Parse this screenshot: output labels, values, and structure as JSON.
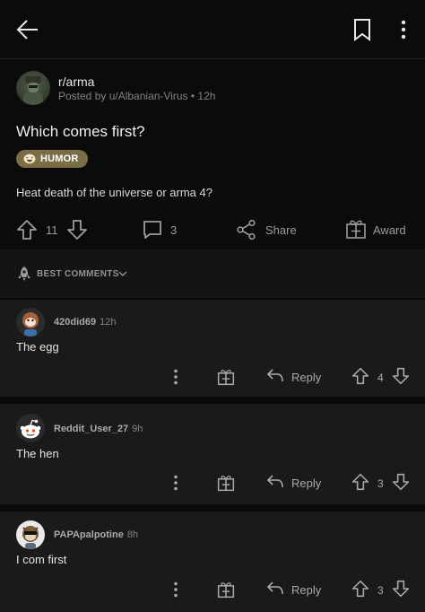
{
  "header": {
    "back_icon": "arrow-left-icon",
    "bookmark_icon": "bookmark-icon",
    "more_icon": "more-vertical-icon"
  },
  "post": {
    "subreddit": "r/arma",
    "posted_by": "Posted by u/Albanian-Virus • 12h",
    "title": "Which comes first?",
    "flair": "HUMOR",
    "body": "Heat death of the universe or arma 4?",
    "votes": "11",
    "comments": "3",
    "share_label": "Share",
    "award_label": "Award",
    "flair_color": "#7b6d45"
  },
  "sort": {
    "label": "BEST COMMENTS"
  },
  "comments": [
    {
      "user": "420did69",
      "time": "12h",
      "text": "The egg",
      "reply_label": "Reply",
      "score": "4"
    },
    {
      "user": "Reddit_User_27",
      "time": "9h",
      "text": "The hen",
      "reply_label": "Reply",
      "score": "3"
    },
    {
      "user": "PAPApalpotine",
      "time": "8h",
      "text": "I com first",
      "reply_label": "Reply",
      "score": "3"
    }
  ]
}
